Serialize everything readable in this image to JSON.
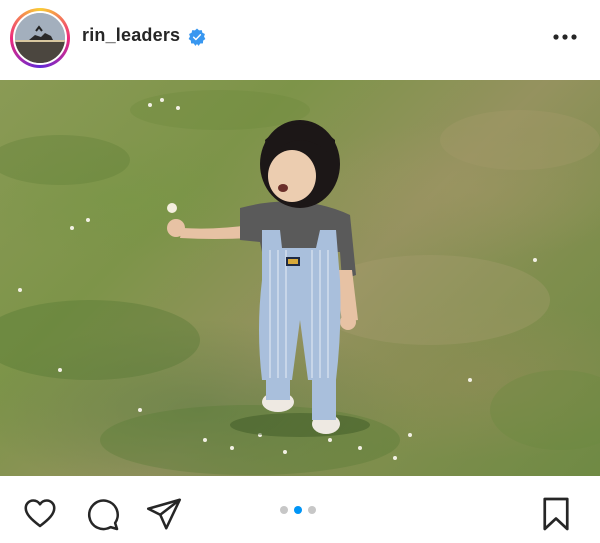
{
  "header": {
    "username": "rin_leaders",
    "verified_icon": "verified-badge-icon",
    "more_icon": "more-options-icon"
  },
  "post": {
    "photo_description_icon": "post-photo",
    "carousel": {
      "count": 3,
      "active_index": 1
    }
  },
  "actions": {
    "like_icon": "heart-icon",
    "comment_icon": "comment-icon",
    "share_icon": "send-icon",
    "save_icon": "bookmark-icon"
  },
  "colors": {
    "verified_blue": "#3897f0",
    "active_dot": "#0095f6",
    "inactive_dot": "#c7c7c7",
    "text": "#262626"
  }
}
